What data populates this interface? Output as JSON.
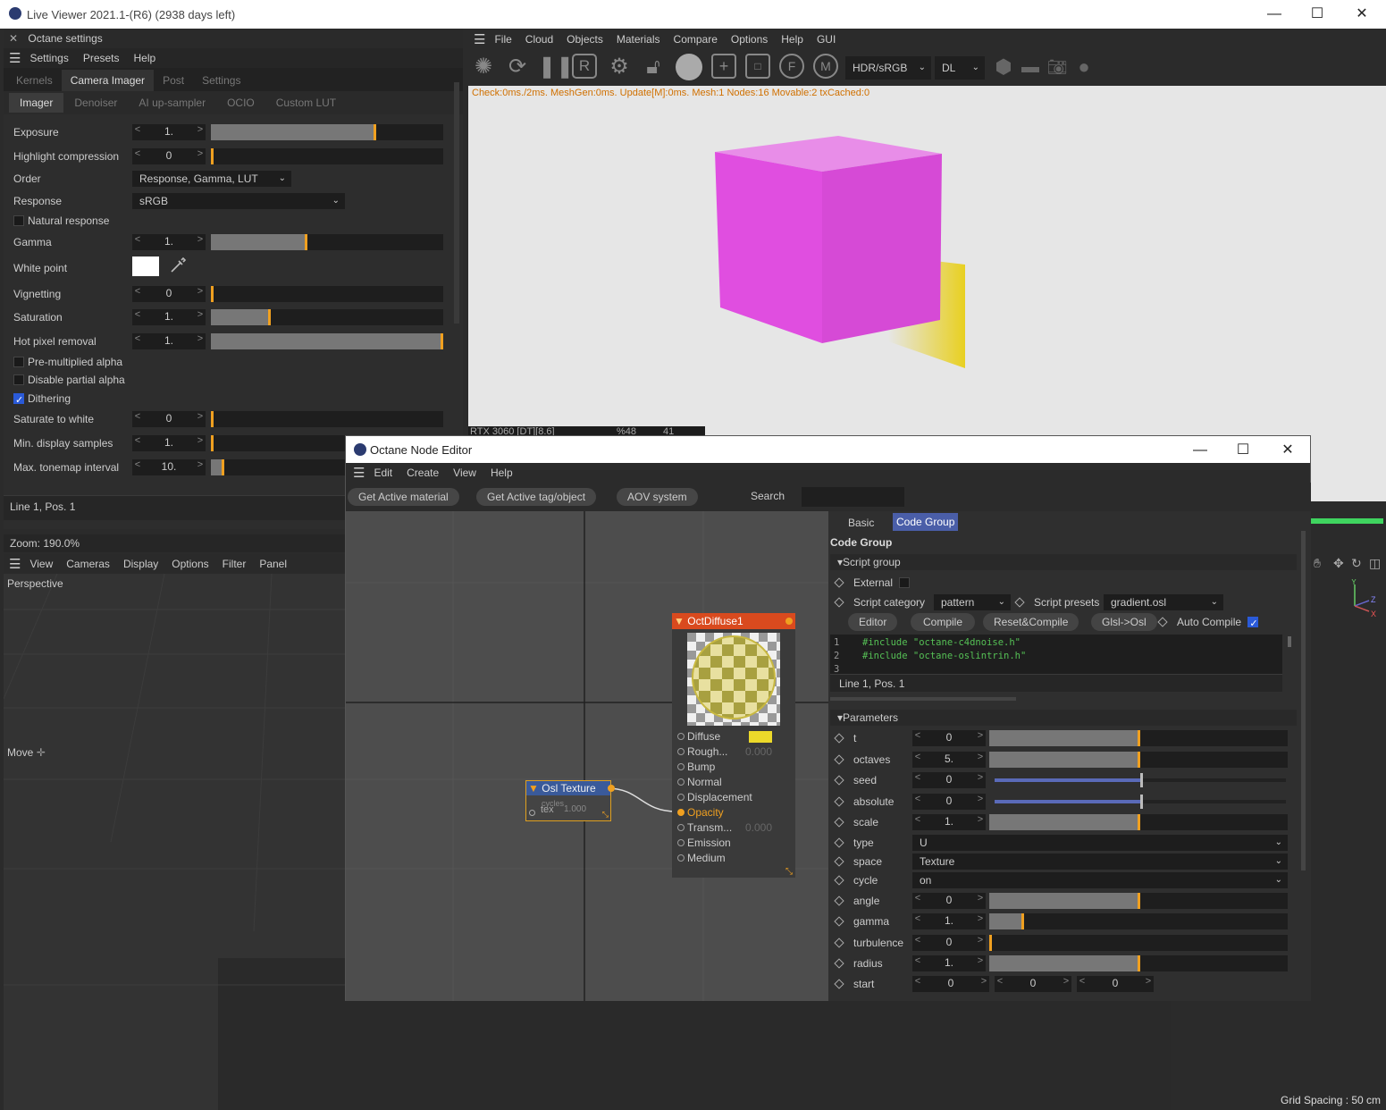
{
  "app": {
    "title": "Live Viewer 2021.1-(R6) (2938 days left)"
  },
  "octane_settings": {
    "title": "Octane settings",
    "menu": [
      "Settings",
      "Presets",
      "Help"
    ],
    "tabs": [
      "Kernels",
      "Camera Imager",
      "Post",
      "Settings"
    ],
    "subtabs": [
      "Imager",
      "Denoiser",
      "AI up-sampler",
      "OCIO",
      "Custom LUT"
    ],
    "rows": {
      "exposure": {
        "label": "Exposure",
        "value": "1.",
        "fill": 0.71
      },
      "highlight": {
        "label": "Highlight compression",
        "value": "0",
        "fill": 0
      },
      "order": {
        "label": "Order",
        "value": "Response, Gamma, LUT"
      },
      "response": {
        "label": "Response",
        "value": "sRGB"
      },
      "natural": {
        "label": "Natural response"
      },
      "gamma": {
        "label": "Gamma",
        "value": "1.",
        "fill": 0.41
      },
      "white": {
        "label": "White point"
      },
      "vignetting": {
        "label": "Vignetting",
        "value": "0",
        "fill": 0
      },
      "saturation": {
        "label": "Saturation",
        "value": "1.",
        "fill": 0.25
      },
      "hotpixel": {
        "label": "Hot pixel removal",
        "value": "1.",
        "fill": 1
      },
      "premult": {
        "label": "Pre-multiplied alpha"
      },
      "partial": {
        "label": "Disable partial alpha"
      },
      "dither": {
        "label": "Dithering"
      },
      "sat_white": {
        "label": "Saturate to white",
        "value": "0",
        "fill": 0
      },
      "min_samples": {
        "label": "Min. display samples",
        "value": "1.",
        "fill": 0
      },
      "max_tonemap": {
        "label": "Max. tonemap interval",
        "value": "10.",
        "fill": 0.08
      }
    },
    "footer": "Line 1, Pos. 1"
  },
  "main_menu": [
    "File",
    "Cloud",
    "Objects",
    "Materials",
    "Compare",
    "Options",
    "Help",
    "GUI"
  ],
  "toolbar": {
    "color_mode": "HDR/sRGB",
    "kernel": "DL"
  },
  "viewport": {
    "status": "Check:0ms./2ms. MeshGen:0ms. Update[M]:0ms. Mesh:1 Nodes:16 Movable:2 txCached:0",
    "gpu": "RTX 3060 [DT][8.6]",
    "pct": "%48",
    "num": "41"
  },
  "view3d": {
    "zoom": "Zoom: 190.0%",
    "menu": [
      "View",
      "Cameras",
      "Display",
      "Options",
      "Filter",
      "Panel"
    ],
    "label": "Perspective",
    "move": "Move",
    "grid": "Grid Spacing : 50 cm"
  },
  "node_editor": {
    "title": "Octane Node Editor",
    "menu": [
      "Edit",
      "Create",
      "View",
      "Help"
    ],
    "buttons": [
      "Get Active material",
      "Get Active tag/object",
      "AOV system"
    ],
    "search_label": "Search",
    "tabs": [
      "Basic",
      "Code Group"
    ],
    "section": "Code Group",
    "script_group": "Script group",
    "external": "External",
    "script_category": "Script category",
    "script_category_val": "pattern",
    "script_presets": "Script presets",
    "script_presets_val": "gradient.osl",
    "actions": [
      "Editor",
      "Compile",
      "Reset&Compile",
      "Glsl->Osl"
    ],
    "auto_compile": "Auto Compile",
    "code": [
      "#include \"octane-c4dnoise.h\"",
      "#include \"octane-oslintrin.h\"",
      ""
    ],
    "code_status": "Line 1, Pos. 1",
    "parameters": "Parameters",
    "params": [
      {
        "name": "t",
        "value": "0",
        "kind": "bar",
        "fill": 0.5
      },
      {
        "name": "octaves",
        "value": "5.",
        "kind": "bar",
        "fill": 0.5
      },
      {
        "name": "seed",
        "value": "0",
        "kind": "slider",
        "fill": 0.5
      },
      {
        "name": "absolute",
        "value": "0",
        "kind": "slider",
        "fill": 0.5
      },
      {
        "name": "scale",
        "value": "1.",
        "kind": "bar",
        "fill": 0.5
      },
      {
        "name": "type",
        "value": "U",
        "kind": "drop"
      },
      {
        "name": "space",
        "value": "Texture",
        "kind": "drop"
      },
      {
        "name": "cycle",
        "value": "on",
        "kind": "drop"
      },
      {
        "name": "angle",
        "value": "0",
        "kind": "bar",
        "fill": 0.5
      },
      {
        "name": "gamma",
        "value": "1.",
        "kind": "bar",
        "fill": 0.11
      },
      {
        "name": "turbulence",
        "value": "0",
        "kind": "bar",
        "fill": 0
      },
      {
        "name": "radius",
        "value": "1.",
        "kind": "bar",
        "fill": 0.5
      }
    ],
    "start": {
      "name": "start",
      "values": [
        "0",
        "0",
        "0"
      ]
    },
    "nodes": {
      "diffuse": {
        "title": "OctDiffuse1",
        "pins": [
          "Diffuse",
          "Rough...",
          "Bump",
          "Normal",
          "Displacement",
          "Opacity",
          "Transm...",
          "Emission",
          "Medium"
        ],
        "rough_val": "0.000",
        "trans_val": "0.000"
      },
      "osl": {
        "title": "Osl Texture",
        "pin": "tex",
        "overlay": "cycles",
        "overlay_val": "1.000"
      }
    }
  },
  "colors": {
    "accent": "#f0a020",
    "node_header": "#d94a1e",
    "osl_header": "#3a5a9a",
    "cube": "#e04ee0"
  }
}
